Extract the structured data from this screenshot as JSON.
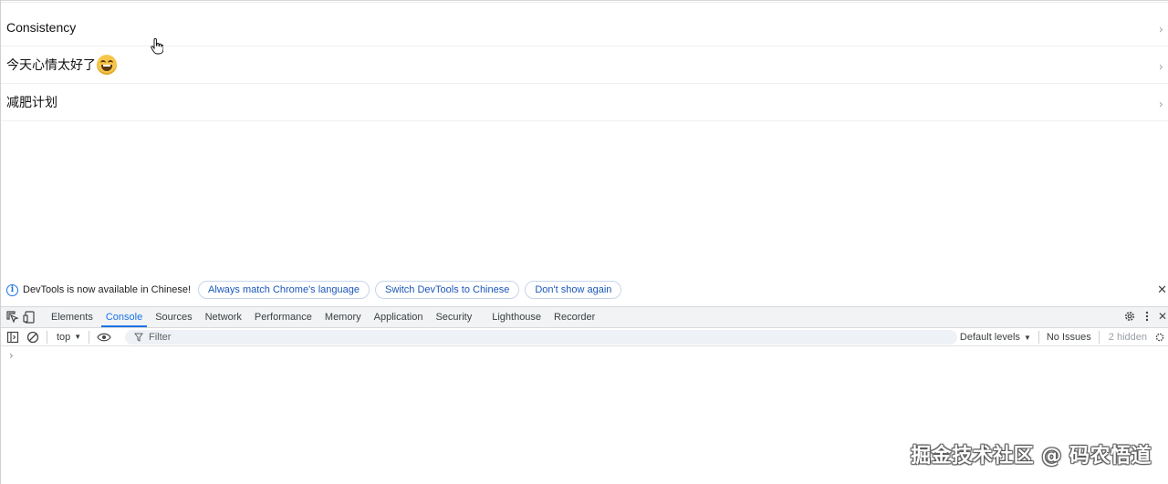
{
  "list": {
    "items": [
      {
        "label": "Consistency",
        "has_emoji": false
      },
      {
        "label": "今天心情太好了",
        "has_emoji": true
      },
      {
        "label": "减肥计划",
        "has_emoji": false
      }
    ],
    "chevron": "›"
  },
  "devtools": {
    "notice": {
      "message": "DevTools is now available in Chinese!",
      "buttons": [
        "Always match Chrome's language",
        "Switch DevTools to Chinese",
        "Don't show again"
      ],
      "close": "✕"
    },
    "tabs": [
      "Elements",
      "Console",
      "Sources",
      "Network",
      "Performance",
      "Memory",
      "Application",
      "Security",
      "Lighthouse",
      "Recorder"
    ],
    "active_tab": "Console",
    "console_toolbar": {
      "context": "top",
      "filter_placeholder": "Filter",
      "levels": "Default levels",
      "issues": "No Issues",
      "hidden": "2 hidden"
    },
    "prompt": "›"
  },
  "watermark": "掘金技术社区 @ 码农悟道",
  "colors": {
    "accent": "#1a73e8",
    "emoji": "#f6c54a"
  }
}
